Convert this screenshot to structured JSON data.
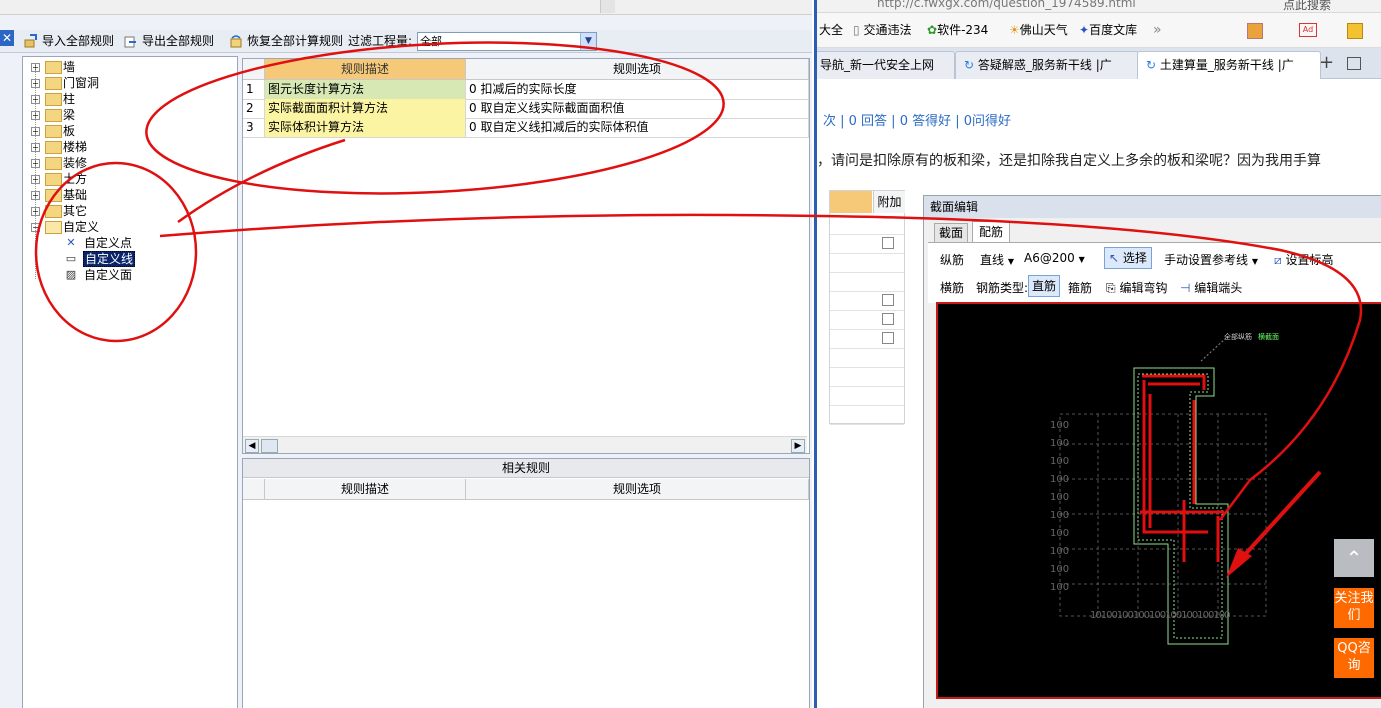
{
  "app": {
    "toolbar": {
      "close_glyph": "✕",
      "import_all_rules": "导入全部规则",
      "export_all_rules": "导出全部规则",
      "restore_all_calc_rules": "恢复全部计算规则",
      "filter_label": "过滤工程量:",
      "filter_value": "全部"
    },
    "tree": {
      "expander_collapsed": "+",
      "expander_expanded": "−",
      "items": [
        "墙",
        "门窗洞",
        "柱",
        "梁",
        "板",
        "楼梯",
        "装修",
        "土方",
        "基础",
        "其它",
        "自定义"
      ],
      "custom_children": [
        "自定义点",
        "自定义线",
        "自定义面"
      ],
      "selected": "自定义线"
    },
    "grid": {
      "col_desc": "规则描述",
      "col_option": "规则选项",
      "rows": [
        {
          "num": "1",
          "desc": "图元长度计算方法",
          "option": "0  扣减后的实际长度"
        },
        {
          "num": "2",
          "desc": "实际截面面积计算方法",
          "option": "0   取自定义线实际截面面积值"
        },
        {
          "num": "3",
          "desc": "实际体积计算方法",
          "option": "0   取自定义线扣减后的实际体积值"
        }
      ]
    },
    "related": {
      "title": "相关规则",
      "col_desc": "规则描述",
      "col_option": "规则选项"
    }
  },
  "browser": {
    "address": "http://c.fwxgx.com/question_1974589.html",
    "search_hint": "点此搜索",
    "favorites": [
      "大全",
      "交通违法",
      "软件-234",
      "佛山天气",
      "百度文库"
    ],
    "more_glyph": "»",
    "tabs": [
      "导航_新一代安全上网",
      "答疑解惑_服务新干线 |广",
      "土建算量_服务新干线 |广"
    ],
    "new_tab_glyph": "+",
    "stats": "次 | 0 回答 | 0 答得好 | 0问得好",
    "question": "，请问是扣除原有的板和梁，还是扣除我自定义上多余的板和梁呢？因为我用手算",
    "table_header": "附加",
    "dialog": {
      "title": "截面编辑",
      "tab_section": "截面",
      "tab_rebar": "配筋",
      "longitudinal": "纵筋",
      "line_type": "直线",
      "rebar_spec": "A6@200",
      "select": "选择",
      "manual_ref": "手动设置参考线",
      "set_elevation": "设置标高",
      "transverse": "横筋",
      "rebar_type_label": "钢筋类型:",
      "straight": "直筋",
      "stirrup": "箍筋",
      "edit_hook": "编辑弯钩",
      "edit_end": "编辑端头",
      "canvas_label_a": "全部纵筋",
      "canvas_label_b": "横截面",
      "spacing_labels": [
        "100",
        "100",
        "100",
        "100",
        "100",
        "100",
        "100",
        "100",
        "100",
        "100"
      ],
      "bottom_spacing": "10100100100100100100100100"
    },
    "float_buttons": {
      "follow": "关注我们",
      "qq": "QQ咨询"
    }
  },
  "colors": {
    "accent": "#2b5fb4",
    "header_orange": "#f6c978",
    "desc_green": "#d7e8b4",
    "desc_yellow": "#fbf5a3",
    "annotation_red": "#e01010",
    "float_orange": "#ff6a00"
  }
}
